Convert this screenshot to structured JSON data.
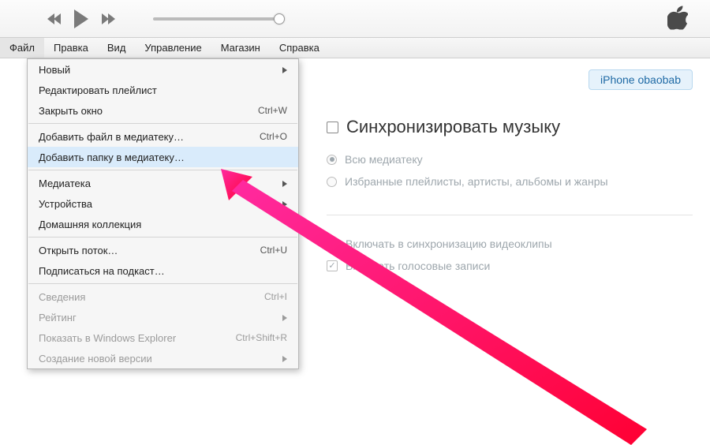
{
  "menubar": {
    "items": [
      "Файл",
      "Правка",
      "Вид",
      "Управление",
      "Магазин",
      "Справка"
    ],
    "active_index": 0
  },
  "dropdown": {
    "items": [
      {
        "label": "Новый",
        "shortcut": "",
        "submenu": true,
        "disabled": false,
        "highlight": false
      },
      {
        "label": "Редактировать плейлист",
        "shortcut": "",
        "submenu": false,
        "disabled": false,
        "highlight": false
      },
      {
        "label": "Закрыть окно",
        "shortcut": "Ctrl+W",
        "submenu": false,
        "disabled": false,
        "highlight": false
      },
      {
        "sep": true
      },
      {
        "label": "Добавить файл в медиатеку…",
        "shortcut": "Ctrl+O",
        "submenu": false,
        "disabled": false,
        "highlight": false
      },
      {
        "label": "Добавить папку в медиатеку…",
        "shortcut": "",
        "submenu": false,
        "disabled": false,
        "highlight": true
      },
      {
        "sep": true
      },
      {
        "label": "Медиатека",
        "shortcut": "",
        "submenu": true,
        "disabled": false,
        "highlight": false
      },
      {
        "label": "Устройства",
        "shortcut": "",
        "submenu": true,
        "disabled": false,
        "highlight": false
      },
      {
        "label": "Домашняя коллекция",
        "shortcut": "",
        "submenu": false,
        "disabled": false,
        "highlight": false
      },
      {
        "sep": true
      },
      {
        "label": "Открыть поток…",
        "shortcut": "Ctrl+U",
        "submenu": false,
        "disabled": false,
        "highlight": false
      },
      {
        "label": "Подписаться на подкаст…",
        "shortcut": "",
        "submenu": false,
        "disabled": false,
        "highlight": false
      },
      {
        "sep": true
      },
      {
        "label": "Сведения",
        "shortcut": "Ctrl+I",
        "submenu": false,
        "disabled": true,
        "highlight": false
      },
      {
        "label": "Рейтинг",
        "shortcut": "",
        "submenu": true,
        "disabled": true,
        "highlight": false
      },
      {
        "label": "Показать в Windows Explorer",
        "shortcut": "Ctrl+Shift+R",
        "submenu": false,
        "disabled": true,
        "highlight": false
      },
      {
        "label": "Создание новой версии",
        "shortcut": "",
        "submenu": true,
        "disabled": true,
        "highlight": false
      }
    ]
  },
  "right": {
    "device_label": "iPhone obaobab",
    "sync_heading": "Синхронизировать музыку",
    "radio_all": "Всю медиатеку",
    "radio_sel": "Избранные плейлисты, артисты, альбомы и жанры",
    "chk_video": "Включать в синхронизацию видеоклипы",
    "chk_voice": "Включать голосовые записи"
  }
}
